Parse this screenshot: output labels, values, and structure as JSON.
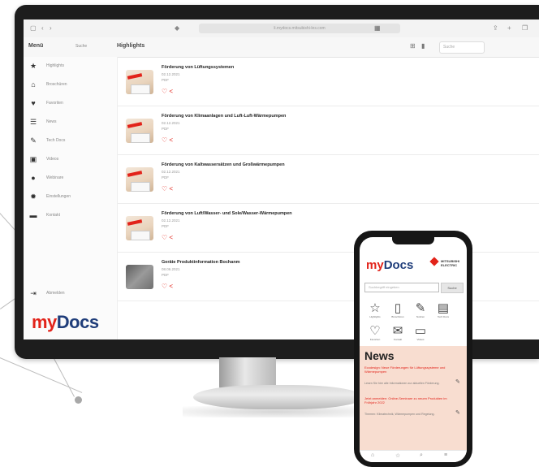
{
  "browser": {
    "url": "li.mydocs.mitsubishi-les.com",
    "nav_icons": [
      "sidebar-toggle-icon",
      "back-icon",
      "forward-icon"
    ],
    "right_icons": [
      "share-icon",
      "new-tab-icon",
      "tabs-icon"
    ]
  },
  "toolbar": {
    "menu_label": "Menü",
    "search_label": "Suche",
    "section_title": "Highlights",
    "search_placeholder": "Suche"
  },
  "sidebar": {
    "items": [
      {
        "icon": "star-icon",
        "label": "Highlights"
      },
      {
        "icon": "binder-icon",
        "label": "Broschüren"
      },
      {
        "icon": "heart-icon",
        "label": "Favoriten"
      },
      {
        "icon": "rss-icon",
        "label": "News"
      },
      {
        "icon": "wrench-icon",
        "label": "Tech Docs"
      },
      {
        "icon": "video-icon",
        "label": "Videos"
      },
      {
        "icon": "globe-icon",
        "label": "Webinare"
      },
      {
        "icon": "settings-icon",
        "label": "Einstellungen"
      },
      {
        "icon": "contact-icon",
        "label": "Kontakt"
      }
    ],
    "footer_item": {
      "icon": "logout-icon",
      "label": "Abmelden"
    },
    "logo": {
      "my": "my",
      "docs": "Docs"
    }
  },
  "documents": [
    {
      "title": "Förderung von Lüftungssystemen",
      "date": "02.12.2021",
      "type": "PDF"
    },
    {
      "title": "Förderung von Klimaanlagen und Luft-Luft-Wärmepumpen",
      "date": "02.12.2021",
      "type": "PDF"
    },
    {
      "title": "Förderung von Kaltwassersätzen und Großwärmepumpen",
      "date": "02.12.2021",
      "type": "PDF"
    },
    {
      "title": "Förderung von Luft/Wasser- und Sole/Wasser-Wärmepumpen",
      "date": "02.12.2021",
      "type": "PDF"
    },
    {
      "title": "Geräte Produktinformation Bochanm",
      "date": "08.06.2021",
      "type": "PDF"
    }
  ],
  "phone": {
    "logo": {
      "my": "my",
      "docs": "Docs"
    },
    "brand_text": "MITSUBISHI ELECTRIC",
    "search_placeholder": "Suchbegriff eingeben",
    "search_button": "Suche",
    "tiles": [
      {
        "icon": "star-icon",
        "label": "Highlights"
      },
      {
        "icon": "binder-icon",
        "label": "Broschüren"
      },
      {
        "icon": "pencil-icon",
        "label": "Notizen"
      },
      {
        "icon": "document-icon",
        "label": "Tech Docs"
      },
      {
        "icon": "heart-icon",
        "label": "Favoriten"
      },
      {
        "icon": "mail-icon",
        "label": "Kontakt"
      },
      {
        "icon": "monitor-icon",
        "label": "Videos"
      }
    ],
    "news_title": "News",
    "news": [
      {
        "headline": "Ecodesign: Neue Förderungen für Lüftungssysteme und Wärmepumpen",
        "text": "Lesen Sie hier alle Informationen zur aktuellen Förderung."
      },
      {
        "headline": "Jetzt anmelden: Online-Seminare zu neuen Produkten im Frühjahr 2022",
        "text": "Themen: Klimatechnik, Wärmepumpen und Regelung."
      }
    ]
  },
  "colors": {
    "brand_red": "#e2231a",
    "brand_blue": "#1f3d7a",
    "news_bg": "#f8ddd0"
  }
}
